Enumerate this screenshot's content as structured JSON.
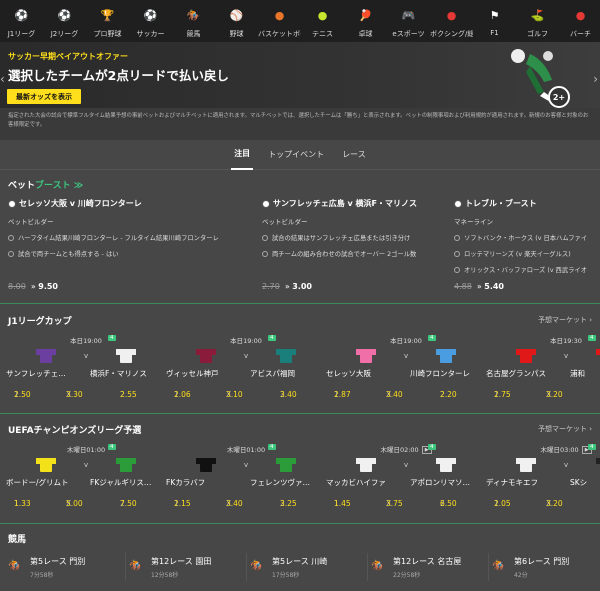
{
  "sports": [
    {
      "label": "J1リーグ",
      "icon": "j1-badge-icon",
      "color": "#c9c9c9"
    },
    {
      "label": "J2リーグ",
      "icon": "j2-badge-icon",
      "color": "#c9c9c9"
    },
    {
      "label": "プロ野球",
      "icon": "trophy-icon",
      "color": "#c9c9c9"
    },
    {
      "label": "サッカー",
      "icon": "soccer-ball-icon",
      "color": "#ffffff"
    },
    {
      "label": "競馬",
      "icon": "horse-racing-icon",
      "color": "#e89f4a"
    },
    {
      "label": "野球",
      "icon": "baseball-icon",
      "color": "#ffffff"
    },
    {
      "label": "バスケットボール",
      "icon": "basketball-icon",
      "color": "#e8752a"
    },
    {
      "label": "テニス",
      "icon": "tennis-ball-icon",
      "color": "#c9e62e"
    },
    {
      "label": "卓球",
      "icon": "table-tennis-icon",
      "color": "#e53935"
    },
    {
      "label": "eスポーツ",
      "icon": "gamepad-icon",
      "color": "#ffffff"
    },
    {
      "label": "ボクシング/総合…",
      "icon": "boxing-glove-icon",
      "color": "#e53935"
    },
    {
      "label": "F1",
      "icon": "checkered-flag-icon",
      "color": "#ffffff"
    },
    {
      "label": "ゴルフ",
      "icon": "golf-icon",
      "color": "#ffffff"
    },
    {
      "label": "バーチ",
      "icon": "virtual-icon",
      "color": "#e53935"
    }
  ],
  "hero": {
    "kicker": "サッカー早期ペイアウトオファー",
    "title": "選択したチームが2点リードで払い戻し",
    "cta": "最新オッズを表示",
    "badge": "2+"
  },
  "disclaimer": "指定された大会の試合で標準フルタイム結果予想の事前ベットおよびマルチベットに適用されます。マルチベットでは、選択したチームは「勝ち」と表示されます。ベットの制限事項および利用規約が適用されます。新規のお客様と対象のお客様限定です。",
  "tabs": [
    {
      "label": "注目",
      "active": true
    },
    {
      "label": "トップイベント"
    },
    {
      "label": "レース"
    }
  ],
  "boost": {
    "title_a": "ベット",
    "title_b": "ブースト",
    "title_arrow": "≫",
    "cards": [
      {
        "title": "セレッソ大阪 v 川崎フロンターレ",
        "sub": "ベットビルダー",
        "legs": [
          "ハーフタイム結果川崎フロンターレ - フルタイム結果川崎フロンターレ",
          "試合で両チームとも得点する - はい"
        ],
        "old": "8.00",
        "new": "9.50"
      },
      {
        "title": "サンフレッチェ広島 v 横浜F・マリノス",
        "sub": "ベットビルダー",
        "legs": [
          "試合の結果はサンフレッチェ広島または引き分け",
          "両チームの組み合わせの試合でオーバー 2ゴール数"
        ],
        "old": "2.70",
        "new": "3.00"
      },
      {
        "title": "トレブル・ブースト",
        "sub": "マネーライン",
        "legs": [
          "ソフトバンク・ホークス (v 日本ハムファイ",
          "ロッテマリーンズ (v 楽天イーグルス)",
          "オリックス・バッファローズ (v 西武ライオ"
        ],
        "old": "4.88",
        "new": "5.40"
      }
    ]
  },
  "j1": {
    "title": "J1リーグカップ",
    "more": "予想マーケット",
    "matches": [
      {
        "time": "本日19:00",
        "live": "4",
        "home": "サンフレッチェ…",
        "away": "横浜F・マリノス",
        "hc": "#6a3fa0",
        "ac": "#f0f0f0",
        "o1": "2.50",
        "ox": "3.30",
        "o2": "2.55"
      },
      {
        "time": "本日19:00",
        "live": "4",
        "home": "ヴィッセル神戸",
        "away": "アビスパ福岡",
        "hc": "#8a1b3a",
        "ac": "#1a7f7a",
        "o1": "2.06",
        "ox": "3.10",
        "o2": "3.40"
      },
      {
        "time": "本日19:00",
        "live": "4",
        "home": "セレッソ大阪",
        "away": "川崎フロンターレ",
        "hc": "#f06fa8",
        "ac": "#4a9de0",
        "o1": "2.87",
        "ox": "3.40",
        "o2": "2.20"
      },
      {
        "time": "本日19:30",
        "live": "4",
        "home": "名古屋グランパス",
        "away": "浦和",
        "hc": "#e01818",
        "ac": "#e01818",
        "o1": "2.75",
        "ox": "3.20",
        "o2": ""
      }
    ]
  },
  "ucl": {
    "title": "UEFAチャンピオンズリーグ予選",
    "more": "予想マーケット",
    "matches": [
      {
        "time": "木曜日01:00",
        "live": "4",
        "tv": "",
        "home": "ボードー/グリムト",
        "away": "FKジャルギリス…",
        "hc": "#f3e21a",
        "ac": "#2c9c3a",
        "o1": "1.33",
        "ox": "5.00",
        "o2": "7.50"
      },
      {
        "time": "木曜日01:00",
        "live": "4",
        "tv": "",
        "home": "FKカラバフ",
        "away": "フェレンツヴァ…",
        "hc": "#111111",
        "ac": "#2c9c3a",
        "o1": "2.15",
        "ox": "3.40",
        "o2": "3.25"
      },
      {
        "time": "木曜日02:00",
        "live": "4",
        "tv": "▶",
        "home": "マッカビハイファ",
        "away": "アポロンリマソ…",
        "hc": "#f0f0f0",
        "ac": "#f0f0f0",
        "o1": "1.45",
        "ox": "3.75",
        "o2": "6.50"
      },
      {
        "time": "木曜日03:00",
        "live": "4",
        "tv": "▶",
        "home": "ディナモキエフ",
        "away": "SKシ",
        "hc": "#f0f0f0",
        "ac": "#222222",
        "o1": "2.05",
        "ox": "3.20",
        "o2": ""
      }
    ]
  },
  "racing": {
    "title": "競馬",
    "races": [
      {
        "name": "第5レース 門別",
        "time": "7分58秒"
      },
      {
        "name": "第12レース 園田",
        "time": "12分58秒"
      },
      {
        "name": "第5レース 川崎",
        "time": "17分58秒"
      },
      {
        "name": "第12レース 名古屋",
        "time": "22分58秒"
      },
      {
        "name": "第6レース 門別",
        "time": "42分"
      }
    ]
  },
  "labels": {
    "one": "1",
    "x": "X",
    "two": "2",
    "vs": "v"
  }
}
